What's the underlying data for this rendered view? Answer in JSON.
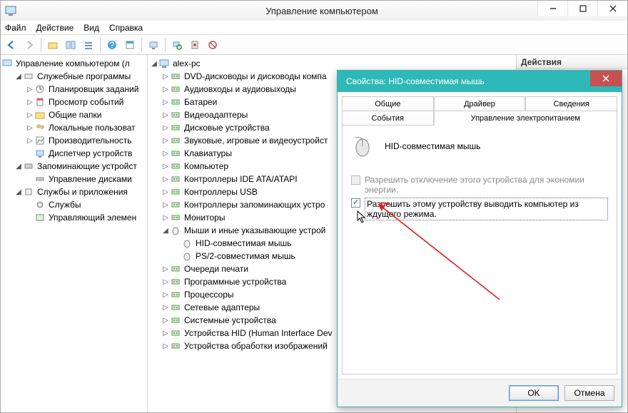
{
  "window": {
    "title": "Управление компьютером",
    "menu": {
      "file": "Файл",
      "action": "Действие",
      "view": "Вид",
      "help": "Справка"
    }
  },
  "actions_pane": {
    "header": "Действия"
  },
  "left_tree": {
    "root": "Управление компьютером (л",
    "groups": [
      {
        "label": "Служебные программы",
        "children": [
          "Планировщик заданий",
          "Просмотр событий",
          "Общие папки",
          "Локальные пользоват",
          "Производительность",
          "Диспетчер устройств"
        ]
      },
      {
        "label": "Запоминающие устройст",
        "children": [
          "Управление дисками"
        ]
      },
      {
        "label": "Службы и приложения",
        "children": [
          "Службы",
          "Управляющий элемен"
        ]
      }
    ]
  },
  "mid_tree": {
    "root": "alex-pc",
    "items": [
      "DVD-дисководы и дисководы компа",
      "Аудиовходы и аудиовыходы",
      "Батареи",
      "Видеоадаптеры",
      "Дисковые устройства",
      "Звуковые, игровые и видеоустройст",
      "Клавиатуры",
      "Компьютер",
      "Контроллеры IDE ATA/ATAPI",
      "Контроллеры USB",
      "Контроллеры запоминающих устро",
      "Мониторы"
    ],
    "mice": {
      "label": "Мыши и иные указывающие устрой",
      "children": [
        "HID-совместимая мышь",
        "PS/2-совместимая мышь"
      ]
    },
    "items2": [
      "Очереди печати",
      "Программные устройства",
      "Процессоры",
      "Сетевые адаптеры",
      "Системные устройства",
      "Устройства HID (Human Interface Dev",
      "Устройства обработки изображений"
    ]
  },
  "dialog": {
    "title": "Свойства: HID-совместимая мышь",
    "tabs": {
      "general": "Общие",
      "driver": "Драйвер",
      "details": "Сведения",
      "events": "События",
      "power": "Управление электропитанием"
    },
    "device": "HID-совместимая мышь",
    "chk_off": "Разрешить отключение этого устройства для экономии энергии.",
    "chk_wake": "Разрешить этому устройству выводить компьютер из ждущего режима.",
    "ok": "OK",
    "cancel": "Отмена"
  }
}
